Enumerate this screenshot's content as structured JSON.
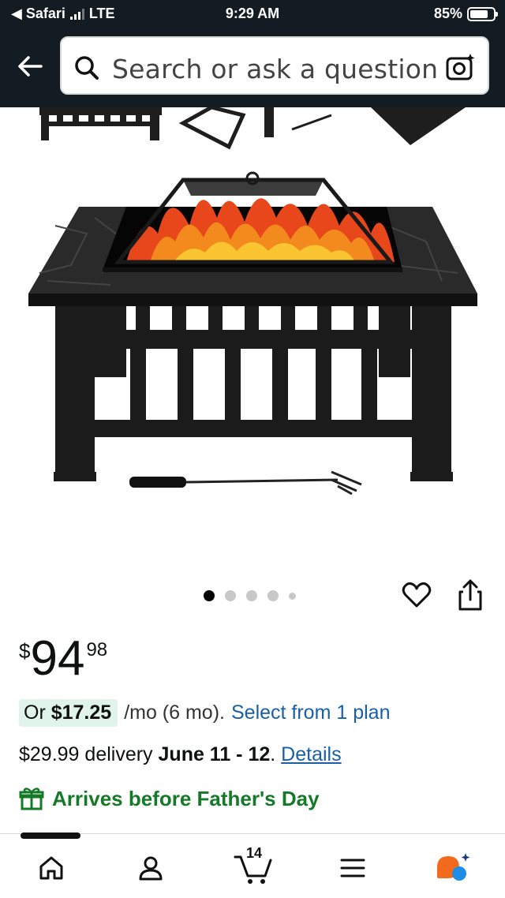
{
  "status_bar": {
    "back_app": "◀ Safari",
    "network": "LTE",
    "time": "9:29 AM",
    "battery": "85%"
  },
  "search": {
    "placeholder": "Search or ask a question"
  },
  "carousel": {
    "total_dots": 5,
    "active_index": 0
  },
  "price": {
    "symbol": "$",
    "whole": "94",
    "fraction": "98"
  },
  "installment": {
    "prefix": "Or ",
    "amount": "$17.25",
    "term": "/mo (6 mo).",
    "link": "Select from 1 plan"
  },
  "delivery": {
    "cost_text": "$29.99 delivery ",
    "dates": "June 11 - 12",
    "separator": ". ",
    "details_link": "Details"
  },
  "gift_banner": {
    "text": "Arrives before Father's Day"
  },
  "bottom_nav": {
    "cart_count": "14"
  },
  "colors": {
    "header_bg": "#141c23",
    "link": "#1a5ea8",
    "gift_green": "#157a28",
    "plan_highlight": "#e0f4ec"
  }
}
